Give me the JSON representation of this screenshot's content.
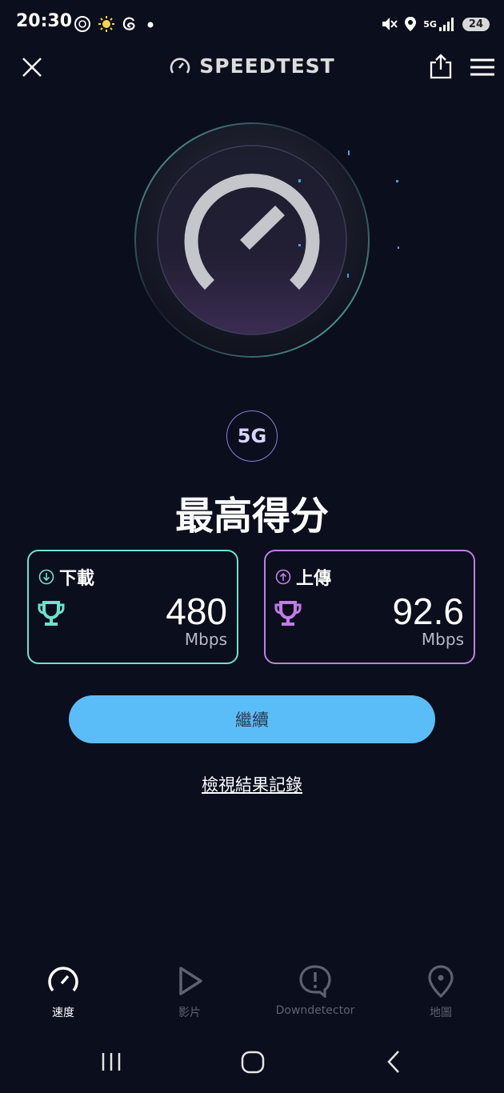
{
  "status_bar": {
    "time": "20:30",
    "left_icons": [
      "threads-ring-icon",
      "sun-icon",
      "threads-icon",
      "dot-icon"
    ],
    "right_icons": [
      "mute-icon",
      "location-icon",
      "5g-signal-icon",
      "battery-icon"
    ],
    "network": "5G",
    "battery": "24"
  },
  "header": {
    "title": "SPEEDTEST",
    "close_icon": "close-icon",
    "share_icon": "share-icon",
    "menu_icon": "menu-icon"
  },
  "network_badge": "5G",
  "result_title": "最高得分",
  "download": {
    "label": "下載",
    "value": "480",
    "unit": "Mbps",
    "color": "#6fe0d0"
  },
  "upload": {
    "label": "上傳",
    "value": "92.6",
    "unit": "Mbps",
    "color": "#c27ce8"
  },
  "continue_label": "繼續",
  "history_link": "檢視結果記錄",
  "bottom_nav": [
    {
      "label": "速度",
      "icon": "speedometer-icon",
      "active": true
    },
    {
      "label": "影片",
      "icon": "play-icon",
      "active": false
    },
    {
      "label": "Downdetector",
      "icon": "alert-bubble-icon",
      "active": false
    },
    {
      "label": "地圖",
      "icon": "map-pin-icon",
      "active": false
    }
  ],
  "colors": {
    "background": "#0b0e1c",
    "accent_button": "#5bbdf7",
    "nav_inactive": "#5d6270"
  }
}
